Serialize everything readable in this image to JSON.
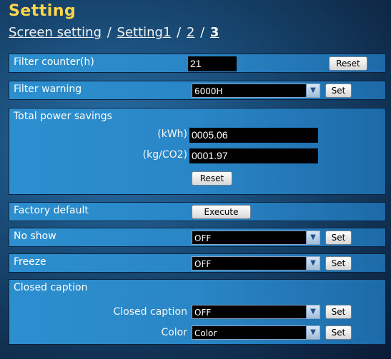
{
  "header": {
    "title": "Setting",
    "breadcrumb": {
      "screen_setting": "Screen setting",
      "sep1": " / ",
      "setting1": "Setting1",
      "sep2": " / ",
      "page2": "2",
      "sep3": " / ",
      "page3": "3"
    }
  },
  "filter_counter": {
    "label": "Filter counter(h)",
    "value": "21",
    "reset_label": "Reset"
  },
  "filter_warning": {
    "label": "Filter warning",
    "selected": "6000H",
    "set_label": "Set"
  },
  "total_power_savings": {
    "label": "Total power savings",
    "kwh_label": "(kWh)",
    "kwh_value": "0005.06",
    "co2_label": "(kg/CO2)",
    "co2_value": "0001.97",
    "reset_label": "Reset"
  },
  "factory_default": {
    "label": "Factory default",
    "execute_label": "Execute"
  },
  "no_show": {
    "label": "No show",
    "selected": "OFF",
    "set_label": "Set"
  },
  "freeze": {
    "label": "Freeze",
    "selected": "OFF",
    "set_label": "Set"
  },
  "closed_caption": {
    "label": "Closed caption",
    "cc_label": "Closed caption",
    "cc_selected": "OFF",
    "cc_set_label": "Set",
    "color_label": "Color",
    "color_selected": "Color",
    "color_set_label": "Set"
  },
  "icons": {
    "dropdown_arrow": "chevron-down-icon"
  },
  "colors": {
    "title": "#ffd54a",
    "row_bg": "#2a86c6",
    "field_bg": "#000000"
  }
}
